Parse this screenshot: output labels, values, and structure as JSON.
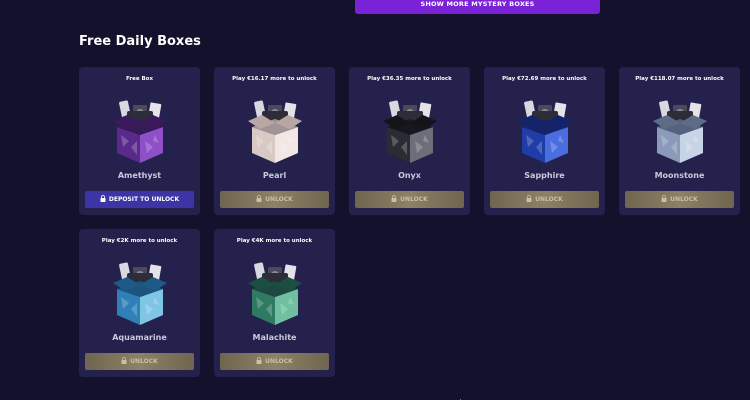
{
  "top_button": {
    "label": "SHOW MORE MYSTERY BOXES"
  },
  "section": {
    "title": "Free Daily Boxes"
  },
  "boxes": [
    {
      "top": "Free Box",
      "name": "Amethyst",
      "button": "DEPOSIT TO UNLOCK",
      "primary": true,
      "colors": [
        "#5a2a8a",
        "#8e4fc7",
        "#3a1a5a"
      ]
    },
    {
      "top": "Play €16.17 more to unlock",
      "name": "Pearl",
      "button": "UNLOCK",
      "primary": false,
      "colors": [
        "#d9c9c4",
        "#f3e7e3",
        "#b8a7a3"
      ]
    },
    {
      "top": "Play €36.35 more to unlock",
      "name": "Onyx",
      "button": "UNLOCK",
      "primary": false,
      "colors": [
        "#2b2b33",
        "#6e6e7a",
        "#151519"
      ]
    },
    {
      "top": "Play €72.69 more to unlock",
      "name": "Sapphire",
      "button": "UNLOCK",
      "primary": false,
      "colors": [
        "#1f3ca8",
        "#4a6ee0",
        "#14246c"
      ]
    },
    {
      "top": "Play €118.07 more to unlock",
      "name": "Moonstone",
      "button": "UNLOCK",
      "primary": false,
      "colors": [
        "#8a9ab8",
        "#c7d3e6",
        "#5e6c88"
      ]
    },
    {
      "top": "Play €2K more to unlock",
      "name": "Aquamarine",
      "button": "UNLOCK",
      "primary": false,
      "colors": [
        "#2f7fb8",
        "#7fc6e6",
        "#1d5a88"
      ]
    },
    {
      "top": "Play €4K more to unlock",
      "name": "Malachite",
      "button": "UNLOCK",
      "primary": false,
      "colors": [
        "#2e7a63",
        "#6fbfa0",
        "#1c4f40"
      ]
    }
  ]
}
